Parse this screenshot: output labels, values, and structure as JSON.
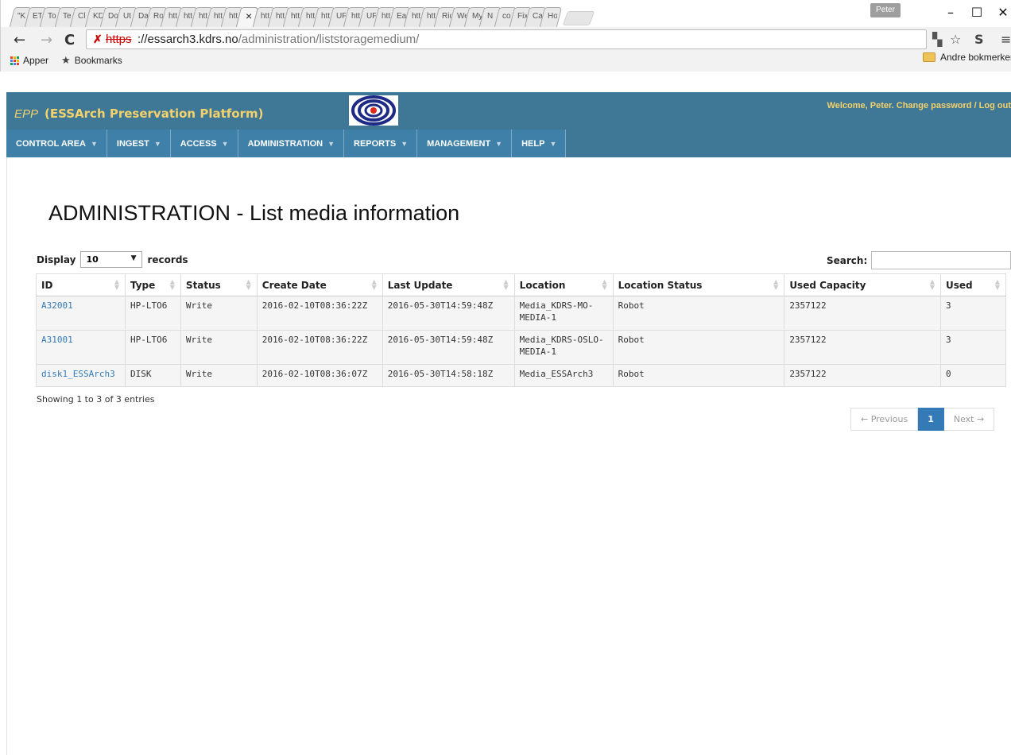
{
  "browser": {
    "tabs": [
      "\"K",
      "ET",
      "To",
      "Te",
      "Cl",
      "KD",
      "Do",
      "Ut",
      "Da",
      "Ro",
      "htt",
      "htt",
      "htt",
      "htt",
      "htt",
      "×",
      "htt",
      "htt",
      "htt",
      "htt",
      "htt",
      "UF",
      "htt",
      "UF",
      "htt",
      "Ea",
      "htt",
      "htt",
      "Ric",
      "We",
      "My",
      "N",
      "co",
      "Fix",
      "Ca",
      "Ho"
    ],
    "user": "Peter",
    "window_controls": [
      "–",
      "☐",
      "✕"
    ],
    "url_scheme": "https",
    "url_host": "://essarch3.kdrs.no",
    "url_path": "/administration/liststoragemedium/",
    "bookmarks": {
      "apps": "Apper",
      "bookmarks": "Bookmarks",
      "other": "Andre bokmerker"
    }
  },
  "app": {
    "brand_short": "EPP",
    "brand_full": "(ESSArch Preservation Platform)",
    "welcome": "Welcome, Peter. Change password / Log out",
    "menu": [
      "CONTROL AREA",
      "INGEST",
      "ACCESS",
      "ADMINISTRATION",
      "REPORTS",
      "MANAGEMENT",
      "HELP"
    ]
  },
  "page": {
    "title": "ADMINISTRATION - List media information",
    "display_label": "Display",
    "display_value": "10",
    "records_label": "records",
    "search_label": "Search:",
    "search_value": "",
    "info": "Showing 1 to 3 of 3 entries",
    "pager": {
      "prev": "← Previous",
      "current": "1",
      "next": "Next →"
    }
  },
  "table": {
    "columns": [
      "ID",
      "Type",
      "Status",
      "Create Date",
      "Last Update",
      "Location",
      "Location Status",
      "Used Capacity",
      "Used"
    ],
    "rows": [
      [
        "A32001",
        "HP-LTO6",
        "Write",
        "2016-02-10T08:36:22Z",
        "2016-05-30T14:59:48Z",
        "Media_KDRS-MO-MEDIA-1",
        "Robot",
        "2357122",
        "3"
      ],
      [
        "A31001",
        "HP-LTO6",
        "Write",
        "2016-02-10T08:36:22Z",
        "2016-05-30T14:59:48Z",
        "Media_KDRS-OSLO-MEDIA-1",
        "Robot",
        "2357122",
        "3"
      ],
      [
        "disk1_ESSArch3",
        "DISK",
        "Write",
        "2016-02-10T08:36:07Z",
        "2016-05-30T14:58:18Z",
        "Media_ESSArch3",
        "Robot",
        "2357122",
        "0"
      ]
    ]
  },
  "colors": {
    "header_bg": "#3f7796",
    "brand_text": "#f4d26b",
    "link": "#337ab7",
    "pager_active": "#337ab7"
  }
}
